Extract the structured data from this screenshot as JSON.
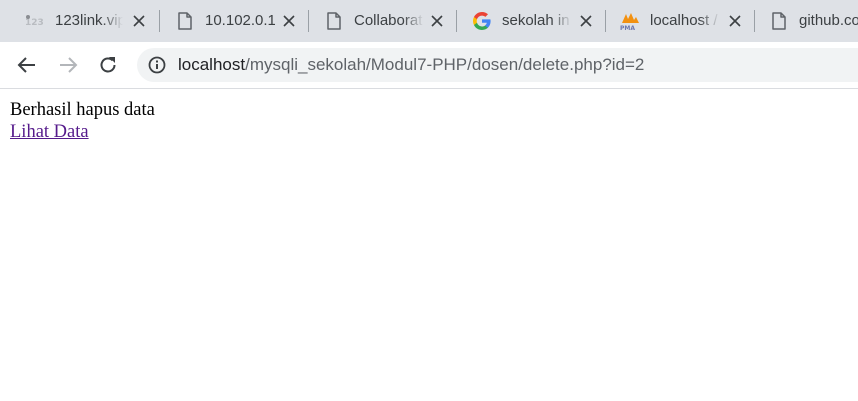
{
  "tabs": [
    {
      "title": "123link.vip",
      "favicon": "123link-favicon"
    },
    {
      "title": "10.102.0.1",
      "favicon": "document-icon"
    },
    {
      "title": "Collaborat",
      "favicon": "document-icon"
    },
    {
      "title": "sekolah in",
      "favicon": "google-icon"
    },
    {
      "title": "localhost /",
      "favicon": "phpmyadmin-icon"
    },
    {
      "title": "github.co",
      "favicon": "document-icon"
    }
  ],
  "address": {
    "host": "localhost",
    "path": "/mysqli_sekolah/Modul7-PHP/dosen/delete.php?id=2"
  },
  "page": {
    "message": "Berhasil hapus data",
    "link_label": "Lihat Data"
  }
}
